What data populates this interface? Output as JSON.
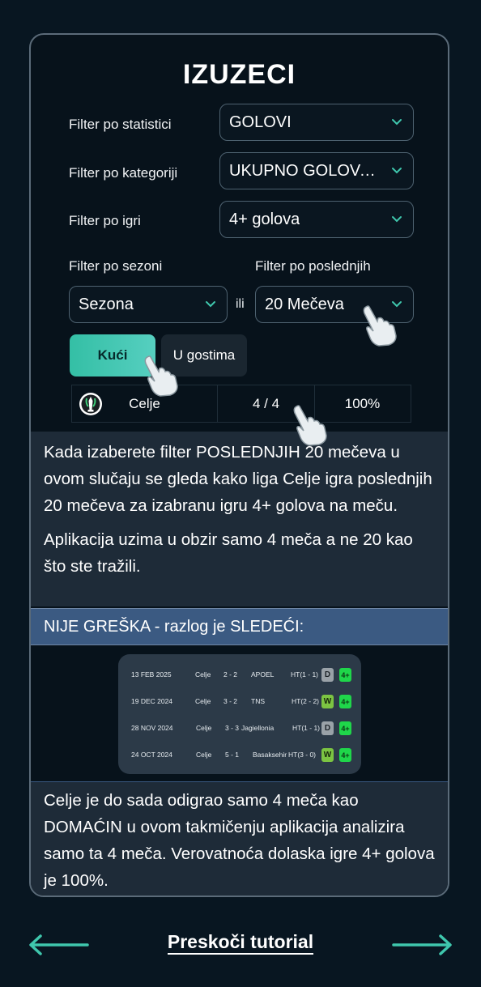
{
  "card": {
    "title": "IZUZECI"
  },
  "filters": {
    "statistika": {
      "label": "Filter po statistici",
      "value": "GOLOVI"
    },
    "kategorija": {
      "label": "Filter po kategoriji",
      "value": "UKUPNO GOLOVA ..."
    },
    "igra": {
      "label": "Filter po igri",
      "value": "4+ golova"
    },
    "sezona": {
      "label": "Filter po sezoni",
      "value": "Sezona"
    },
    "poslednjih": {
      "label": "Filter po poslednjih",
      "value": "20 Mečeva"
    },
    "ili": "ili"
  },
  "venue": {
    "home_label": "Kući",
    "away_label": "U gostima"
  },
  "result_row": {
    "team": "Celje",
    "ratio": "4 / 4",
    "percent": "100%"
  },
  "explanation": {
    "p1": "Kada izaberete filter POSLEDNJIH 20 mečeva u ovom slučaju se gleda kako liga Celje igra poslednjih 20 mečeva za izabranu igru 4+ golova na meču.",
    "p2": "Aplikacija uzima u obzir samo 4 meča a ne 20 kao što ste tražili."
  },
  "banner": "NIJE GREŠKA - razlog je SLEDEĆI:",
  "matches": [
    {
      "date": "13 FEB 2025",
      "home": "Celje",
      "score": "2 - 2",
      "away": "APOEL",
      "ht": "HT(1 - 1)",
      "result": "D",
      "goals": "4+"
    },
    {
      "date": "19 DEC 2024",
      "home": "Celje",
      "score": "3 - 2",
      "away": "TNS",
      "ht": "HT(2 - 2)",
      "result": "W",
      "goals": "4+"
    },
    {
      "date": "28 NOV 2024",
      "home": "Celje",
      "score": "3 - 3",
      "away": "Jagiellonia",
      "ht": "HT(1 - 1)",
      "result": "D",
      "goals": "4+"
    },
    {
      "date": "24 OCT 2024",
      "home": "Celje",
      "score": "5 - 1",
      "away": "Basaksehir",
      "ht": "HT(3 - 0)",
      "result": "W",
      "goals": "4+"
    }
  ],
  "conclusion": "Celje je do sada odigrao samo 4 meča kao DOMAĆIN u ovom takmičenju aplikacija analizira samo ta 4 meča. Verovatnoća dolaska igre 4+ golova je 100%.",
  "footer": {
    "skip_label": "Preskoči tutorial"
  },
  "colors": {
    "accent": "#3fc7ad",
    "banner": "#3b5a82",
    "panel": "#1e2b38",
    "background": "#081621"
  }
}
